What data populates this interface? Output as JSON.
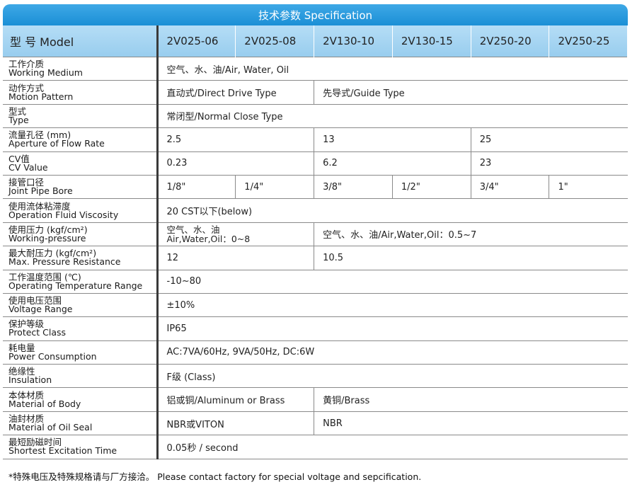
{
  "title": "技术参数 Specification",
  "header": {
    "label": "型 号 Model",
    "models": [
      "2V025-06",
      "2V025-08",
      "2V130-10",
      "2V130-15",
      "2V250-20",
      "2V250-25"
    ]
  },
  "rows": [
    {
      "cn": "工作介质",
      "en": "Working Medium",
      "cells": [
        {
          "text": "空气、水、油/Air, Water, Oil",
          "span": 6
        }
      ]
    },
    {
      "cn": "动作方式",
      "en": "Motion Pattern",
      "cells": [
        {
          "text": "直动式/Direct Drive Type",
          "span": 2
        },
        {
          "text": "先导式/Guide Type",
          "span": 4
        }
      ]
    },
    {
      "cn": "型式",
      "en": "Type",
      "cells": [
        {
          "text": "常闭型/Normal Close Type",
          "span": 6
        }
      ]
    },
    {
      "cn": "流量孔径 (mm)",
      "en": "Aperture of Flow Rate",
      "cells": [
        {
          "text": "2.5",
          "span": 2
        },
        {
          "text": "13",
          "span": 2
        },
        {
          "text": "25",
          "span": 2
        }
      ]
    },
    {
      "cn": "CV值",
      "en": "CV Value",
      "cells": [
        {
          "text": "0.23",
          "span": 2
        },
        {
          "text": "6.2",
          "span": 2
        },
        {
          "text": "23",
          "span": 2
        }
      ]
    },
    {
      "cn": "接管口径",
      "en": "Joint Pipe Bore",
      "cells": [
        {
          "text": "1/8\"",
          "span": 1
        },
        {
          "text": "1/4\"",
          "span": 1
        },
        {
          "text": "3/8\"",
          "span": 1
        },
        {
          "text": "1/2\"",
          "span": 1
        },
        {
          "text": "3/4\"",
          "span": 1
        },
        {
          "text": "1\"",
          "span": 1
        }
      ]
    },
    {
      "cn": "使用流体粘滞度",
      "en": "Operation Fluid Viscosity",
      "cells": [
        {
          "text": "20  CST以下(below)",
          "span": 6
        }
      ]
    },
    {
      "cn": "使用压力 (kgf/cm²)",
      "en": "Working-pressure",
      "cells": [
        {
          "text": "空气、水、油",
          "text2": "Air,Water,Oil：0~8",
          "span": 2
        },
        {
          "text": "空气、水、油/Air,Water,Oil：0.5~7",
          "span": 4
        }
      ]
    },
    {
      "cn": "最大耐压力 (kgf/cm²)",
      "en": "Max. Pressure Resistance",
      "cells": [
        {
          "text": "12",
          "span": 2
        },
        {
          "text": "10.5",
          "span": 4
        }
      ]
    },
    {
      "cn": "工作温度范围 (℃)",
      "en": "Operating Temperature Range",
      "cells": [
        {
          "text": "-10~80",
          "span": 6
        }
      ]
    },
    {
      "cn": "使用电压范围",
      "en": "Voltage Range",
      "cells": [
        {
          "text": "±10%",
          "span": 6
        }
      ]
    },
    {
      "cn": "保护等级",
      "en": "Protect Class",
      "cells": [
        {
          "text": "IP65",
          "span": 6
        }
      ]
    },
    {
      "cn": "耗电量",
      "en": "Power Consumption",
      "cells": [
        {
          "text": "AC:7VA/60Hz, 9VA/50Hz, DC:6W",
          "span": 6
        }
      ]
    },
    {
      "cn": "绝缘性",
      "en": "Insulation",
      "cells": [
        {
          "text": "F级 (Class)",
          "span": 6
        }
      ]
    },
    {
      "cn": "本体材质",
      "en": "Material of Body",
      "cells": [
        {
          "text": "铝或铜/Aluminum or Brass",
          "span": 2
        },
        {
          "text": "黄铜/Brass",
          "span": 4
        }
      ]
    },
    {
      "cn": "油封材质",
      "en": "Material of Oil Seal",
      "cells": [
        {
          "text": "NBR或VITON",
          "span": 2
        },
        {
          "text": "NBR",
          "span": 4
        }
      ]
    },
    {
      "cn": "最短励磁时间",
      "en": "Shortest Excitation Time",
      "cells": [
        {
          "text": "0.05秒 / second",
          "span": 6
        }
      ]
    }
  ],
  "note": "*特殊电压及特殊规格请与厂方接洽。  Please contact factory for special voltage and sepcification."
}
